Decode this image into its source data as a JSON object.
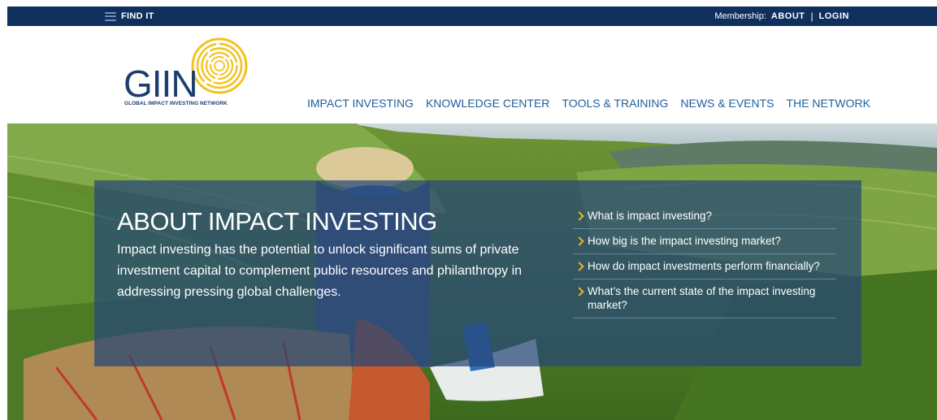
{
  "topbar": {
    "find_it": "FIND IT",
    "membership_label": "Membership:",
    "about": "ABOUT",
    "separator": "|",
    "login": "LOGIN"
  },
  "logo": {
    "wordmark": "GIIN",
    "tagline": "GLOBAL IMPACT INVESTING NETWORK"
  },
  "nav": [
    "IMPACT INVESTING",
    "KNOWLEDGE CENTER",
    "TOOLS & TRAINING",
    "NEWS & EVENTS",
    "THE NETWORK"
  ],
  "hero": {
    "title": "ABOUT IMPACT INVESTING",
    "text": "Impact investing has the potential to unlock significant sums of private investment capital to complement public resources and philanthropy in addressing pressing global challenges.",
    "links": [
      "What is impact investing?",
      "How big is the impact investing market?",
      "How do impact investments perform financially?",
      "What’s the current state of the impact investing market?"
    ]
  },
  "colors": {
    "topbar_bg": "#0f2f5c",
    "nav_link": "#1f5f9a",
    "accent_yellow": "#f3b61b",
    "overlay": "#254777"
  }
}
